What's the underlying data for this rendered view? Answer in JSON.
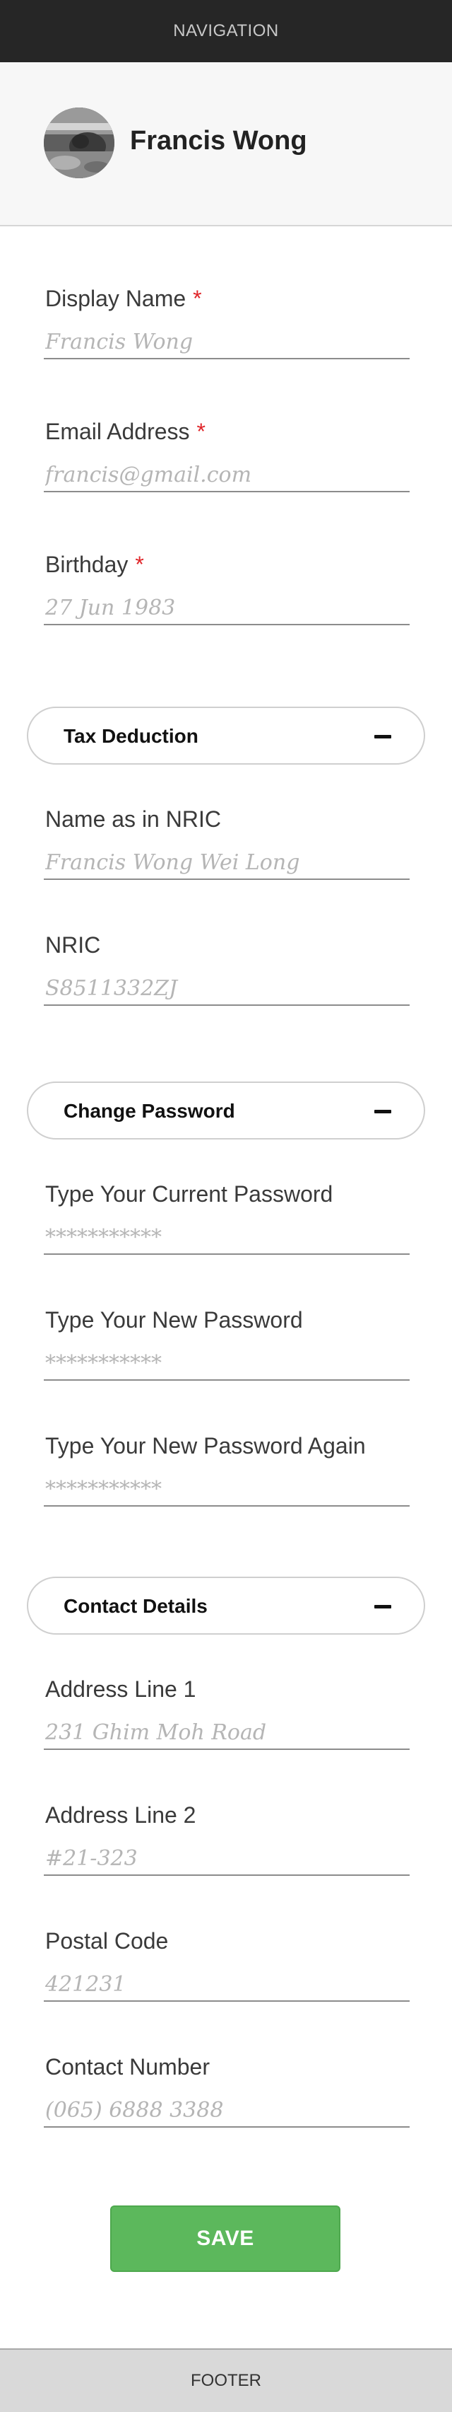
{
  "navigation": {
    "label": "NAVIGATION"
  },
  "profile": {
    "name": "Francis Wong",
    "avatar_icon": "avatar-photo"
  },
  "personal_fields": [
    {
      "label": "Display Name",
      "required_mark": "*",
      "placeholder": "Francis Wong"
    },
    {
      "label": "Email Address",
      "required_mark": "*",
      "placeholder": "francis@gmail.com"
    },
    {
      "label": "Birthday",
      "required_mark": "*",
      "placeholder": "27 Jun 1983"
    }
  ],
  "sections": [
    {
      "title": "Tax Deduction",
      "toggle_icon": "minus-icon",
      "fields": [
        {
          "label": "Name as in NRIC",
          "placeholder": "Francis Wong Wei Long"
        },
        {
          "label": "NRIC",
          "placeholder": "S8511332ZJ"
        }
      ]
    },
    {
      "title": "Change Password",
      "toggle_icon": "minus-icon",
      "fields": [
        {
          "label": "Type Your Current Password",
          "placeholder": "***********"
        },
        {
          "label": "Type Your New Password",
          "placeholder": "***********"
        },
        {
          "label": "Type Your New Password Again",
          "placeholder": "***********"
        }
      ]
    },
    {
      "title": "Contact Details",
      "toggle_icon": "minus-icon",
      "fields": [
        {
          "label": "Address Line 1",
          "placeholder": "231 Ghim Moh Road"
        },
        {
          "label": "Address Line 2",
          "placeholder": "#21-323"
        },
        {
          "label": "Postal Code",
          "placeholder": "421231"
        },
        {
          "label": "Contact Number",
          "placeholder": "(065) 6888 3388"
        }
      ]
    }
  ],
  "actions": {
    "save_label": "SAVE"
  },
  "footer": {
    "label": "FOOTER"
  },
  "colors": {
    "nav_background": "#262626",
    "required": "#e0262a",
    "save_button": "#5cb85c",
    "footer_background": "#d9d9d9"
  }
}
